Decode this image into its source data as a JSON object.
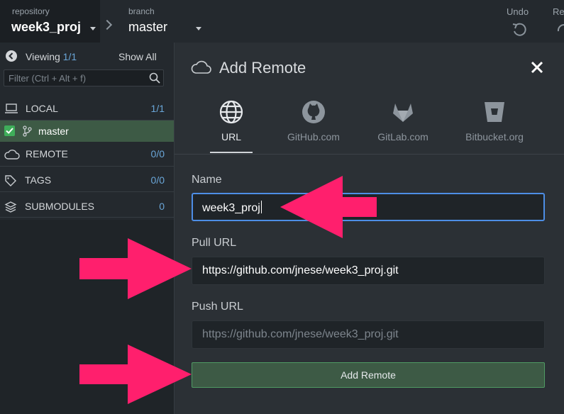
{
  "toolbar": {
    "repository_label": "repository",
    "repository_name": "week3_proj",
    "branch_label": "branch",
    "branch_name": "master",
    "undo_label": "Undo",
    "redo_label": "Re"
  },
  "sidebar": {
    "viewing_label": "Viewing",
    "viewing_count": "1/1",
    "show_all": "Show All",
    "filter_placeholder": "Filter (Ctrl + Alt + f)",
    "sections": {
      "local": {
        "label": "LOCAL",
        "count": "1/1"
      },
      "remote": {
        "label": "REMOTE",
        "count": "0/0"
      },
      "tags": {
        "label": "TAGS",
        "count": "0/0"
      },
      "submodules": {
        "label": "SUBMODULES",
        "count": "0"
      }
    },
    "branch": {
      "label": "master"
    }
  },
  "dialog": {
    "title": "Add Remote",
    "tabs": [
      {
        "label": "URL",
        "icon": "globe-icon"
      },
      {
        "label": "GitHub.com",
        "icon": "github-icon"
      },
      {
        "label": "GitLab.com",
        "icon": "gitlab-icon"
      },
      {
        "label": "Bitbucket.org",
        "icon": "bitbucket-icon"
      }
    ],
    "active_tab": "URL",
    "name_label": "Name",
    "name_value": "week3_proj",
    "pull_url_label": "Pull URL",
    "pull_url_value": "https://github.com/jnese/week3_proj.git",
    "push_url_label": "Push URL",
    "push_url_placeholder": "https://github.com/jnese/week3_proj.git",
    "submit_label": "Add Remote"
  },
  "colors": {
    "accent_green": "#3d5a45",
    "focus_blue": "#4d8ee6",
    "annotation_arrow": "#ff1f6d"
  }
}
